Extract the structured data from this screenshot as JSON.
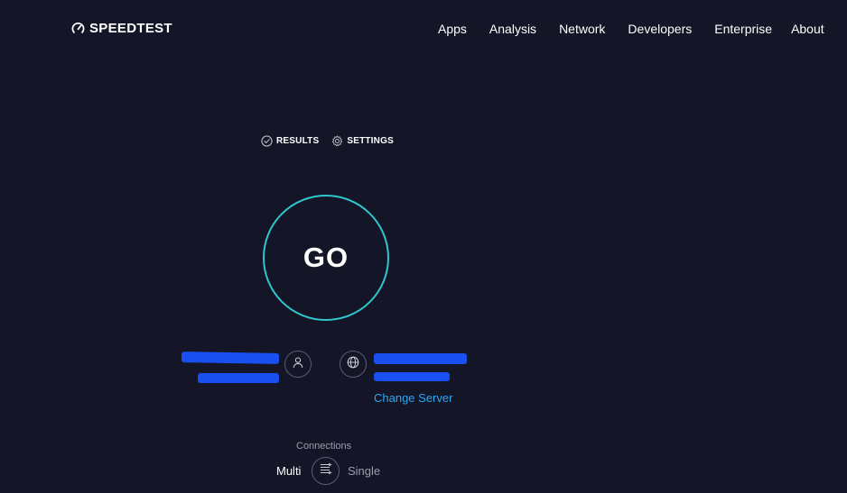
{
  "header": {
    "logo_text": "SPEEDTEST",
    "logo_icon": "speedometer-icon",
    "nav": [
      {
        "label": "Apps"
      },
      {
        "label": "Analysis"
      },
      {
        "label": "Network"
      },
      {
        "label": "Developers"
      },
      {
        "label": "Enterprise"
      },
      {
        "label": "About"
      }
    ]
  },
  "actions": {
    "results_label": "RESULTS",
    "results_icon": "check-circle-icon",
    "settings_label": "SETTINGS",
    "settings_icon": "gear-icon"
  },
  "test": {
    "go_label": "GO"
  },
  "provider": {
    "isp_icon": "user-icon",
    "server_icon": "globe-icon",
    "change_server_label": "Change Server"
  },
  "connections": {
    "label": "Connections",
    "multi_label": "Multi",
    "single_label": "Single",
    "toggle_icon": "connections-toggle-icon"
  },
  "colors": {
    "background": "#141526",
    "accent_ring": "#2fc6cc",
    "link": "#2aa8f5",
    "redaction": "#1a4ff0"
  }
}
